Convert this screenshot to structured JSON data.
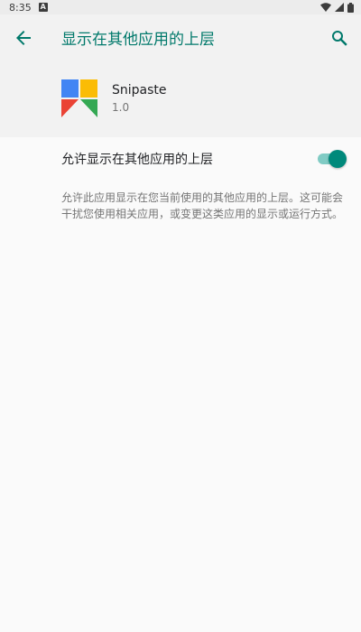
{
  "status_bar": {
    "time": "8:35",
    "notification_badge": "A",
    "icons": [
      "wifi-icon",
      "cell-signal-icon",
      "battery-icon"
    ]
  },
  "app_bar": {
    "title": "显示在其他应用的上层",
    "back_icon": "arrow-back-icon",
    "search_icon": "search-icon"
  },
  "app_info": {
    "name": "Snipaste",
    "version": "1.0"
  },
  "permission": {
    "title": "允许显示在其他应用的上层",
    "enabled": true
  },
  "summary": "允许此应用显示在您当前使用的其他应用的上层。这可能会干扰您使用相关应用，或变更这类应用的显示或运行方式。",
  "colors": {
    "accent": "#00796b",
    "switch_thumb": "#00897b",
    "switch_track": "#80cbc4",
    "header_bg": "#f2f2f2",
    "page_bg": "#fafafa"
  }
}
